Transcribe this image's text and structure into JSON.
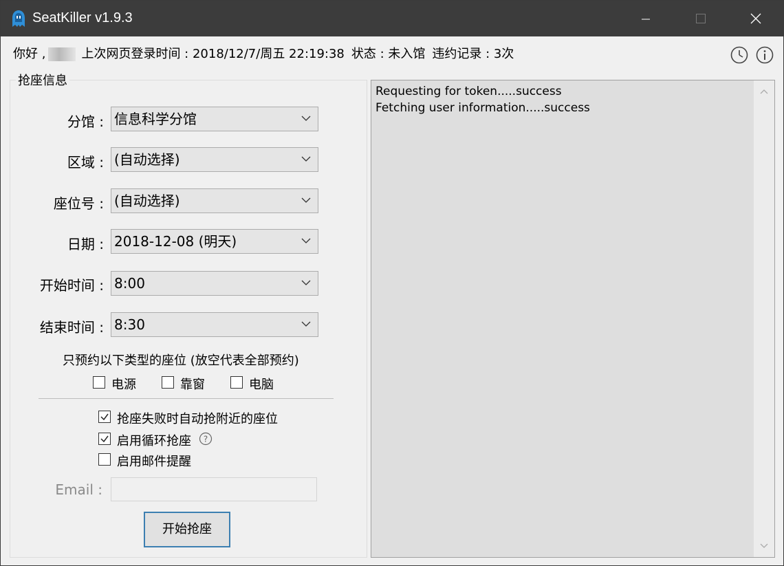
{
  "window": {
    "title": "SeatKiller v1.9.3",
    "icon": "app-ghost-icon"
  },
  "infobar": {
    "greeting": "你好 ,",
    "last_login": "上次网页登录时间 : 2018/12/7/周五 22:19:38",
    "status": "状态 : 未入馆",
    "violations": "违约记录 : 3次"
  },
  "group": {
    "title": "抢座信息",
    "fields": [
      {
        "label": "分馆 :",
        "value": "信息科学分馆"
      },
      {
        "label": "区域 :",
        "value": "(自动选择)"
      },
      {
        "label": "座位号 :",
        "value": "(自动选择)"
      },
      {
        "label": "日期 :",
        "value": "2018-12-08 (明天)"
      },
      {
        "label": "开始时间 :",
        "value": "8:00"
      },
      {
        "label": "结束时间 :",
        "value": "8:30"
      }
    ],
    "seat_type_note": "只预约以下类型的座位 (放空代表全部预约)",
    "seat_types": [
      {
        "label": "电源",
        "checked": false
      },
      {
        "label": "靠窗",
        "checked": false
      },
      {
        "label": "电脑",
        "checked": false
      }
    ],
    "options": [
      {
        "label": "抢座失败时自动抢附近的座位",
        "checked": true
      },
      {
        "label": "启用循环抢座",
        "checked": true
      },
      {
        "label": "启用邮件提醒",
        "checked": false
      }
    ],
    "email_label": "Email :",
    "email_value": "",
    "start_button": "开始抢座"
  },
  "log": {
    "lines": [
      "Requesting for token.....success",
      "Fetching user information.....success"
    ]
  },
  "colors": {
    "titlebar": "#3c3c3c",
    "accent": "#3c7fb1",
    "log_bg": "#dedede"
  }
}
